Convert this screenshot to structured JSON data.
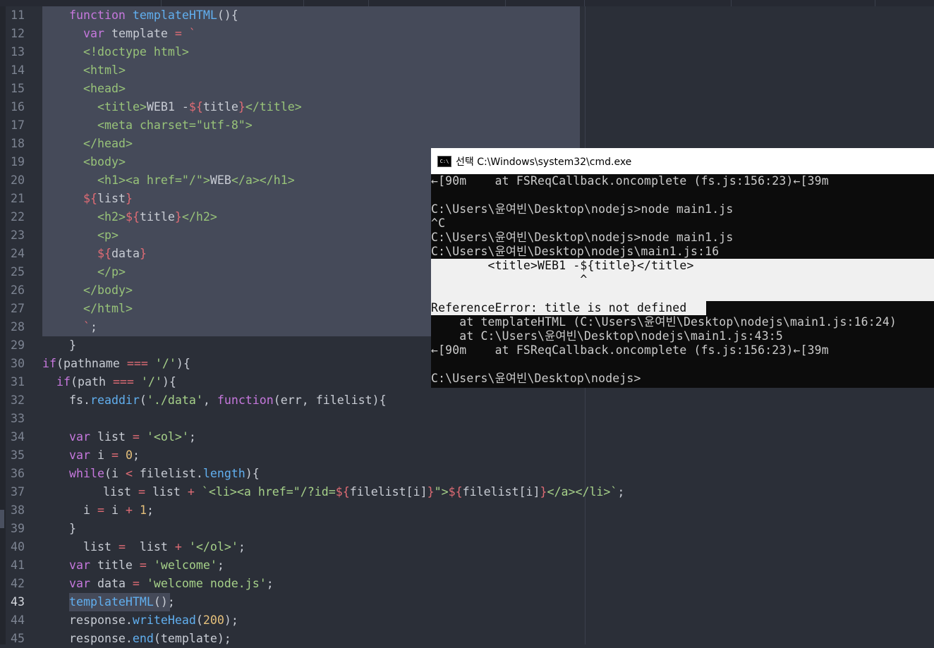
{
  "editor": {
    "current_line": "43",
    "lines": [
      {
        "n": "11",
        "parts": [
          [
            "kw",
            "function "
          ],
          [
            "fn",
            "templateHTML"
          ],
          [
            "pl",
            "(){"
          ]
        ],
        "indent": 38
      },
      {
        "n": "12",
        "parts": [
          [
            "kw",
            "var "
          ],
          [
            "pl",
            "template "
          ],
          [
            "tpl",
            "= `"
          ]
        ],
        "indent": 58
      },
      {
        "n": "13",
        "parts": [
          [
            "tag",
            "<!doctype html>"
          ]
        ],
        "indent": 58
      },
      {
        "n": "14",
        "parts": [
          [
            "tag",
            "<html>"
          ]
        ],
        "indent": 58
      },
      {
        "n": "15",
        "parts": [
          [
            "tag",
            "<head>"
          ]
        ],
        "indent": 58
      },
      {
        "n": "16",
        "parts": [
          [
            "tag",
            "<title>"
          ],
          [
            "pl",
            "WEB1 -"
          ],
          [
            "tpl",
            "${"
          ],
          [
            "pl",
            "title"
          ],
          [
            "tpl",
            "}"
          ],
          [
            "tag",
            "</title>"
          ]
        ],
        "indent": 78
      },
      {
        "n": "17",
        "parts": [
          [
            "tag",
            "<meta charset=\"utf-8\">"
          ]
        ],
        "indent": 78
      },
      {
        "n": "18",
        "parts": [
          [
            "tag",
            "</head>"
          ]
        ],
        "indent": 58
      },
      {
        "n": "19",
        "parts": [
          [
            "tag",
            "<body>"
          ]
        ],
        "indent": 58
      },
      {
        "n": "20",
        "parts": [
          [
            "tag",
            "<h1><a href=\"/\">"
          ],
          [
            "pl",
            "WEB"
          ],
          [
            "tag",
            "</a></h1>"
          ]
        ],
        "indent": 78
      },
      {
        "n": "21",
        "parts": [
          [
            "tpl",
            "${"
          ],
          [
            "pl",
            "list"
          ],
          [
            "tpl",
            "}"
          ]
        ],
        "indent": 58
      },
      {
        "n": "22",
        "parts": [
          [
            "tag",
            "<h2>"
          ],
          [
            "tpl",
            "${"
          ],
          [
            "pl",
            "title"
          ],
          [
            "tpl",
            "}"
          ],
          [
            "tag",
            "</h2>"
          ]
        ],
        "indent": 78
      },
      {
        "n": "23",
        "parts": [
          [
            "tag",
            "<p>"
          ]
        ],
        "indent": 78
      },
      {
        "n": "24",
        "parts": [
          [
            "tpl",
            "${"
          ],
          [
            "pl",
            "data"
          ],
          [
            "tpl",
            "}"
          ]
        ],
        "indent": 78
      },
      {
        "n": "25",
        "parts": [
          [
            "tag",
            "</p>"
          ]
        ],
        "indent": 78
      },
      {
        "n": "26",
        "parts": [
          [
            "tag",
            "</body>"
          ]
        ],
        "indent": 58
      },
      {
        "n": "27",
        "parts": [
          [
            "tag",
            "</html>"
          ]
        ],
        "indent": 58
      },
      {
        "n": "28",
        "parts": [
          [
            "tpl",
            "`"
          ],
          [
            "pl",
            ";"
          ]
        ],
        "indent": 58
      },
      {
        "n": "29",
        "parts": [
          [
            "pl",
            "}"
          ]
        ],
        "indent": 38
      },
      {
        "n": "30",
        "parts": [
          [
            "kw",
            "if"
          ],
          [
            "pl",
            "(pathname "
          ],
          [
            "tpl",
            "==="
          ],
          [
            "pl",
            " "
          ],
          [
            "str",
            "'/'"
          ],
          [
            "pl",
            "){"
          ]
        ],
        "indent": 0
      },
      {
        "n": "31",
        "parts": [
          [
            "kw",
            "if"
          ],
          [
            "pl",
            "(path "
          ],
          [
            "tpl",
            "==="
          ],
          [
            "pl",
            " "
          ],
          [
            "str",
            "'/'"
          ],
          [
            "pl",
            "){"
          ]
        ],
        "indent": 20
      },
      {
        "n": "32",
        "parts": [
          [
            "pl",
            "fs."
          ],
          [
            "fn",
            "readdir"
          ],
          [
            "pl",
            "("
          ],
          [
            "str",
            "'./data'"
          ],
          [
            "pl",
            ", "
          ],
          [
            "kw",
            "function"
          ],
          [
            "pl",
            "(err, filelist){"
          ]
        ],
        "indent": 38
      },
      {
        "n": "33",
        "parts": [],
        "indent": 38
      },
      {
        "n": "34",
        "parts": [
          [
            "kw",
            "var "
          ],
          [
            "pl",
            "list "
          ],
          [
            "tpl",
            "= "
          ],
          [
            "str",
            "'<ol>'"
          ],
          [
            "pl",
            ";"
          ]
        ],
        "indent": 38
      },
      {
        "n": "35",
        "parts": [
          [
            "kw",
            "var "
          ],
          [
            "pl",
            "i "
          ],
          [
            "tpl",
            "= "
          ],
          [
            "num",
            "0"
          ],
          [
            "pl",
            ";"
          ]
        ],
        "indent": 38
      },
      {
        "n": "36",
        "parts": [
          [
            "kw",
            "while"
          ],
          [
            "pl",
            "(i "
          ],
          [
            "tpl",
            "<"
          ],
          [
            "pl",
            " filelist."
          ],
          [
            "fn",
            "length"
          ],
          [
            "pl",
            ")"
          ],
          [
            "pl",
            "{"
          ]
        ],
        "indent": 38
      },
      {
        "n": "37",
        "parts": [
          [
            "pl",
            "list "
          ],
          [
            "tpl",
            "="
          ],
          [
            "pl",
            " list "
          ],
          [
            "tpl",
            "+"
          ],
          [
            "pl",
            " "
          ],
          [
            "str",
            "`<li><a href=\"/?id="
          ],
          [
            "tpl",
            "${"
          ],
          [
            "pl",
            "filelist[i]"
          ],
          [
            "tpl",
            "}"
          ],
          [
            "str",
            "\">"
          ],
          [
            "tpl",
            "${"
          ],
          [
            "pl",
            "filelist[i]"
          ],
          [
            "tpl",
            "}"
          ],
          [
            "str",
            "</a></li>`"
          ],
          [
            "pl",
            ";"
          ]
        ],
        "indent": 86
      },
      {
        "n": "38",
        "parts": [
          [
            "pl",
            "i "
          ],
          [
            "tpl",
            "="
          ],
          [
            "pl",
            " i "
          ],
          [
            "tpl",
            "+"
          ],
          [
            "pl",
            " "
          ],
          [
            "num",
            "1"
          ],
          [
            "pl",
            ";"
          ]
        ],
        "indent": 58
      },
      {
        "n": "39",
        "parts": [
          [
            "pl",
            "}"
          ]
        ],
        "indent": 38
      },
      {
        "n": "40",
        "parts": [
          [
            "pl",
            "list "
          ],
          [
            "tpl",
            "="
          ],
          [
            "pl",
            "  list "
          ],
          [
            "tpl",
            "+"
          ],
          [
            "pl",
            " "
          ],
          [
            "str",
            "'</ol>'"
          ],
          [
            "pl",
            ";"
          ]
        ],
        "indent": 58
      },
      {
        "n": "41",
        "parts": [
          [
            "kw",
            "var "
          ],
          [
            "pl",
            "title "
          ],
          [
            "tpl",
            "= "
          ],
          [
            "str",
            "'welcome'"
          ],
          [
            "pl",
            ";"
          ]
        ],
        "indent": 38
      },
      {
        "n": "42",
        "parts": [
          [
            "kw",
            "var "
          ],
          [
            "pl",
            "data "
          ],
          [
            "tpl",
            "= "
          ],
          [
            "str",
            "'welcome node.js'"
          ],
          [
            "pl",
            ";"
          ]
        ],
        "indent": 38
      },
      {
        "n": "43",
        "parts": [
          [
            "fn",
            "templateHTML"
          ],
          [
            "pl",
            "();"
          ]
        ],
        "indent": 38
      },
      {
        "n": "44",
        "parts": [
          [
            "pl",
            "response."
          ],
          [
            "fn",
            "writeHead"
          ],
          [
            "pl",
            "("
          ],
          [
            "num",
            "200"
          ],
          [
            "pl",
            ");"
          ]
        ],
        "indent": 38
      },
      {
        "n": "45",
        "parts": [
          [
            "pl",
            "response."
          ],
          [
            "fn",
            "end"
          ],
          [
            "pl",
            "(template);"
          ]
        ],
        "indent": 38
      }
    ]
  },
  "cmd": {
    "title": "선택 C:\\Windows\\system32\\cmd.exe",
    "icon_label": "C:\\",
    "lines": [
      "←[90m    at FSReqCallback.oncomplete (fs.js:156:23)←[39m",
      "",
      "C:\\Users\\윤여빈\\Desktop\\nodejs>node main1.js",
      "^C",
      "C:\\Users\\윤여빈\\Desktop\\nodejs>node main1.js",
      "C:\\Users\\윤여빈\\Desktop\\nodejs\\main1.js:16",
      "        <title>WEB1 -${title}</title>",
      "                     ^",
      "",
      "ReferenceError: title is not defined",
      "    at templateHTML (C:\\Users\\윤여빈\\Desktop\\nodejs\\main1.js:16:24)",
      "    at C:\\Users\\윤여빈\\Desktop\\nodejs\\main1.js:43:5",
      "←[90m    at FSReqCallback.oncomplete (fs.js:156:23)←[39m",
      "",
      "C:\\Users\\윤여빈\\Desktop\\nodejs>"
    ]
  }
}
